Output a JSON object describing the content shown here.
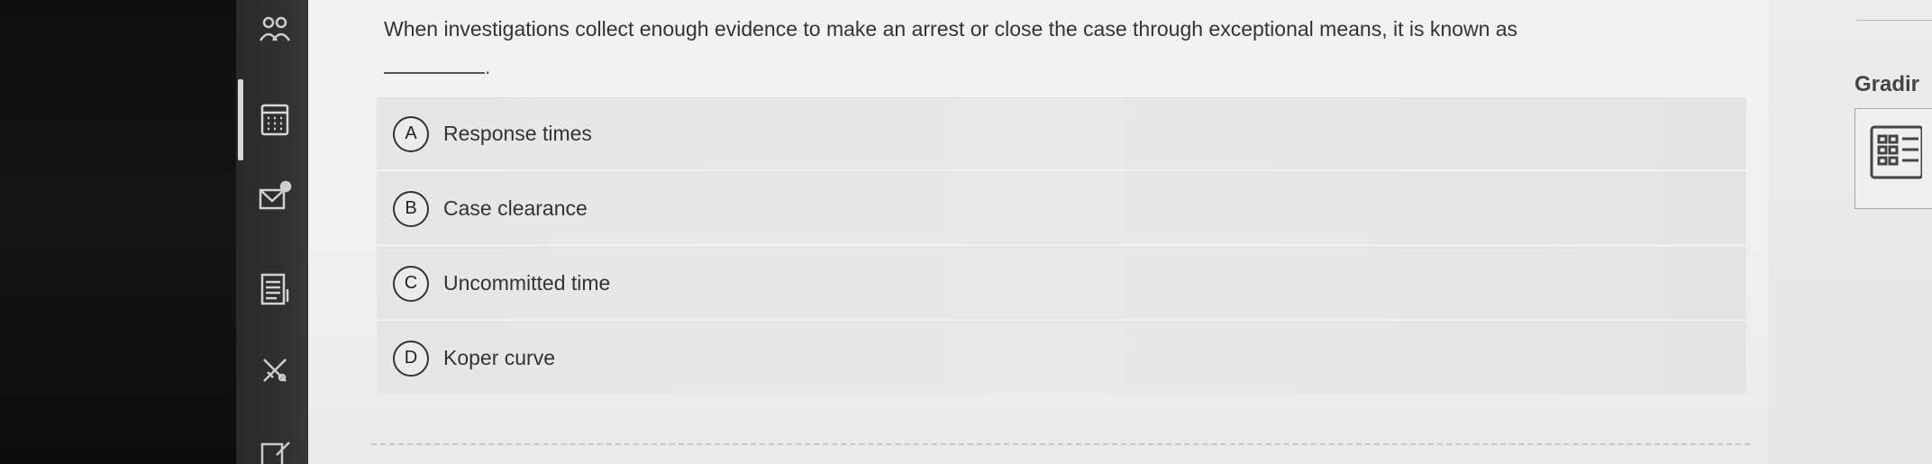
{
  "question": {
    "text": "When investigations collect enough evidence to make an arrest or close the case through exceptional means, it is known as",
    "blank_suffix": "."
  },
  "options": [
    {
      "letter": "A",
      "label": "Response times"
    },
    {
      "letter": "B",
      "label": "Case clearance"
    },
    {
      "letter": "C",
      "label": "Uncommitted time"
    },
    {
      "letter": "D",
      "label": "Koper curve"
    }
  ],
  "right_panel": {
    "heading": "Gradir"
  },
  "sidebar": {
    "icons": [
      "people-icon",
      "calculator-icon",
      "mail-icon",
      "document-icon",
      "tools-icon",
      "edit-icon"
    ]
  },
  "colors": {
    "text": "#333333",
    "option_bg": "#e6e6e6",
    "sidebar_bg": "#2f2f2f"
  }
}
